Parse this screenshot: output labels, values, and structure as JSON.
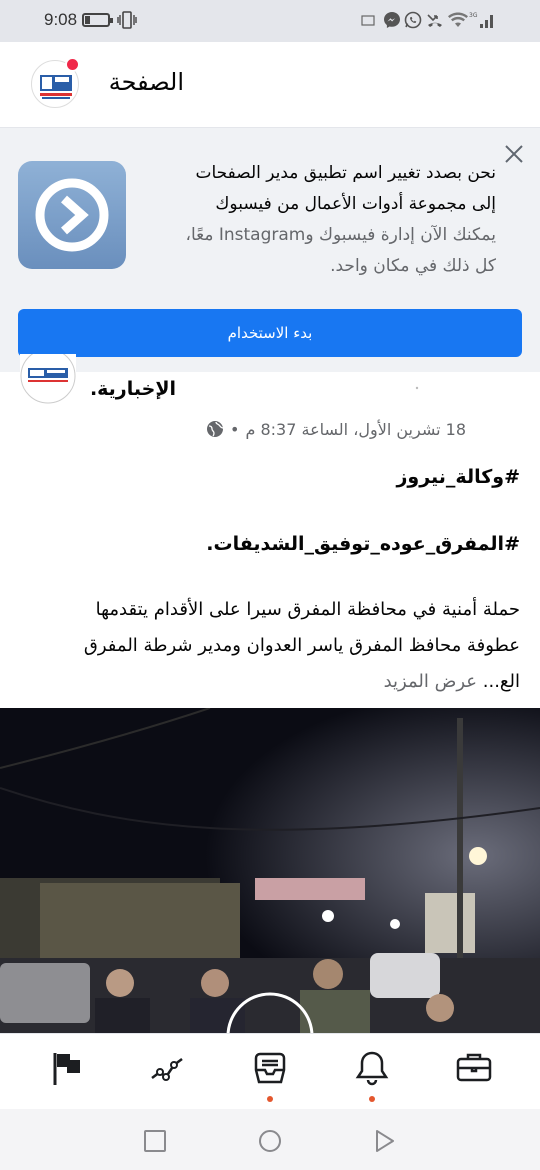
{
  "status_bar": {
    "time": "9:08",
    "battery_level_percent": 20,
    "network": "3G"
  },
  "header": {
    "title": "الصفحة",
    "has_notification_badge": true
  },
  "banner": {
    "line1": "نحن بصدد تغيير اسم تطبيق مدير الصفحات",
    "line2": "إلى مجموعة أدوات الأعمال من فيسبوك",
    "line3": "يمكنك الآن إدارة فيسبوك وInstagram معًا،",
    "line4": "كل ذلك في مكان واحد.",
    "button_label": "بدء الاستخدام"
  },
  "post": {
    "author": "الإخبارية.",
    "date": "18 تشرين الأول، الساعة 8:37 م",
    "separator": "•",
    "hashtag1": "#وكالة_نيروز",
    "hashtag2": "#المفرق_عوده_توفيق_الشديفات.",
    "body_line1": "حملة أمنية في محافظة المفرق سيرا على الأقدام يتقدمها",
    "body_line2": "عطوفة محافظ المفرق ياسر العدوان ومدير شرطة المفرق",
    "body_line3": "الع...",
    "see_more": "عرض المزيد"
  },
  "bottom_nav": {
    "items": [
      {
        "icon": "flag-icon",
        "has_dot": false
      },
      {
        "icon": "insights-icon",
        "has_dot": false
      },
      {
        "icon": "inbox-icon",
        "has_dot": true
      },
      {
        "icon": "bell-icon",
        "has_dot": true
      },
      {
        "icon": "briefcase-icon",
        "has_dot": false
      }
    ]
  },
  "colors": {
    "primary": "#1877f2",
    "badge": "#f02849",
    "nav_dot": "#e4572e",
    "muted_text": "#65676b"
  }
}
